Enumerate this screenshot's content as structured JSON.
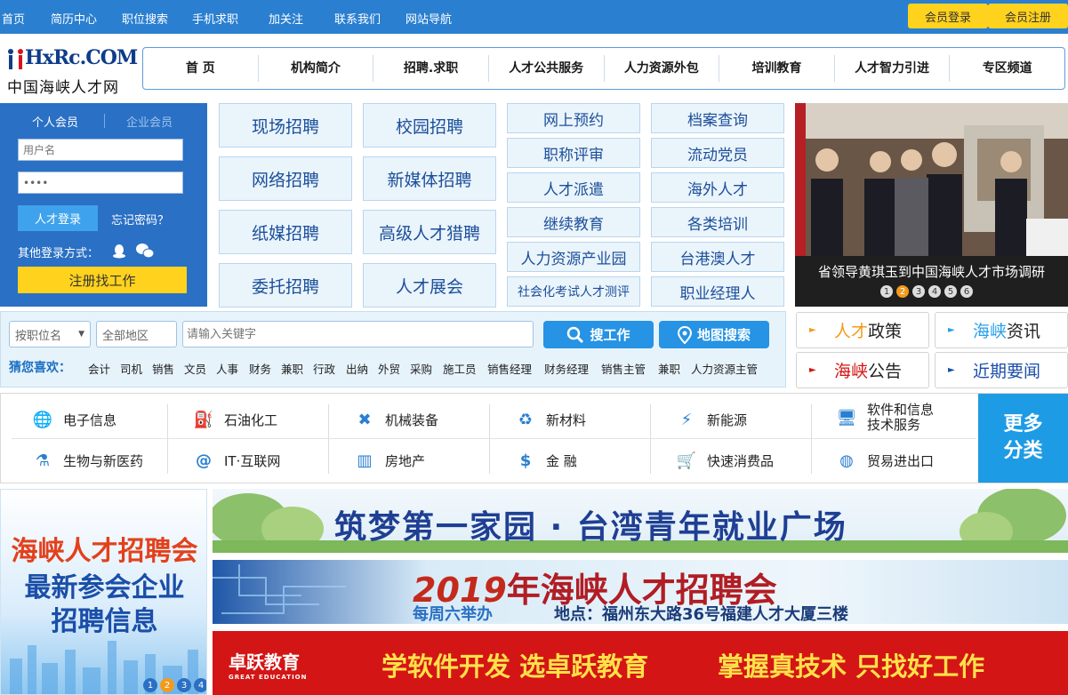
{
  "topbar": {
    "links": [
      "首页",
      "简历中心",
      "职位搜索",
      "手机求职",
      "加关注",
      "联系我们",
      "网站导航"
    ],
    "member_login": "会员登录",
    "member_register": "会员注册"
  },
  "logo": {
    "text_top": "HxRc.COM",
    "text_bottom": "中国海峡人才网"
  },
  "mainnav": [
    "首 页",
    "机构简介",
    "招聘.求职",
    "人才公共服务",
    "人力资源外包",
    "培训教育",
    "人才智力引进",
    "专区频道"
  ],
  "login": {
    "tab_personal": "个人会员",
    "tab_company": "企业会员",
    "username_placeholder": "用户名",
    "password_value": "••••",
    "login_button": "人才登录",
    "forgot": "忘记密码？",
    "other_login": "其他登录方式：",
    "register_button": "注册找工作"
  },
  "recruit_tiles": [
    "现场招聘",
    "校园招聘",
    "网络招聘",
    "新媒体招聘",
    "纸媒招聘",
    "高级人才猎聘",
    "委托招聘",
    "人才展会"
  ],
  "service_tiles": [
    "网上预约",
    "档案查询",
    "职称评审",
    "流动党员",
    "人才派遣",
    "海外人才",
    "继续教育",
    "各类培训",
    "人力资源产业园",
    "台港澳人才",
    "社会化考试人才测评",
    "职业经理人"
  ],
  "slideshow": {
    "caption": "省领导黄琪玉到中国海峡人才市场调研",
    "dots": [
      "1",
      "2",
      "3",
      "4",
      "5",
      "6"
    ],
    "active": 2
  },
  "search": {
    "by_position": "按职位名",
    "region": "全部地区",
    "keyword_placeholder": "请输入关键字",
    "search_jobs": "搜工作",
    "map_search": "地图搜索",
    "guess_label": "猜您喜欢：",
    "keywords": [
      "会计",
      "司机",
      "销售",
      "文员",
      "人事",
      "财务",
      "兼职",
      "行政",
      "出纳",
      "外贸",
      "采购",
      "施工员",
      "销售经理",
      "财务经理",
      "销售主管",
      "兼职",
      "人力资源主管"
    ]
  },
  "news_buttons": [
    {
      "accent": "人才",
      "rest": "政策"
    },
    {
      "accent": "海峡",
      "rest": "资讯"
    },
    {
      "accent": "海峡",
      "rest": "公告"
    },
    {
      "accent": "",
      "rest": "近期要闻"
    }
  ],
  "categories": [
    {
      "label": "电子信息",
      "icon": "globe-icon"
    },
    {
      "label": "石油化工",
      "icon": "fuel-pump-icon"
    },
    {
      "label": "机械装备",
      "icon": "tools-icon"
    },
    {
      "label": "新材料",
      "icon": "recycle-icon"
    },
    {
      "label": "新能源",
      "icon": "power-tower-icon"
    },
    {
      "label": "软件和信息技术服务",
      "icon": "computer-icon"
    },
    {
      "label": "生物与新医药",
      "icon": "flask-icon"
    },
    {
      "label": "IT·互联网",
      "icon": "at-icon"
    },
    {
      "label": "房地产",
      "icon": "buildings-icon"
    },
    {
      "label": "金 融",
      "icon": "dollar-icon"
    },
    {
      "label": "快速消费品",
      "icon": "cart-icon"
    },
    {
      "label": "贸易进出口",
      "icon": "globe-trade-icon"
    }
  ],
  "more_categories": "更多分类",
  "left_banner": {
    "title": "海峡人才招聘会",
    "subtitle1": "最新参会企业",
    "subtitle2": "招聘信息",
    "dots": [
      "1",
      "2",
      "3",
      "4"
    ]
  },
  "banner1": {
    "text": "筑梦第一家园 · 台湾青年就业广场"
  },
  "banner2": {
    "year": "2019",
    "title": "年海峡人才招聘会",
    "sub1": "每周六举办",
    "sub2": "地点：福州东大路36号福建人才大厦三楼"
  },
  "banner3": {
    "brand": "卓跃教育",
    "brand_en": "GREAT EDUCATION",
    "slogan1": "学软件开发 选卓跃教育",
    "slogan2": "掌握真技术 只找好工作"
  },
  "colors": {
    "primary": "#2a7fd0",
    "yellow": "#ffd21e",
    "accent_orange": "#f39a1e",
    "accent_red": "#d41515"
  }
}
